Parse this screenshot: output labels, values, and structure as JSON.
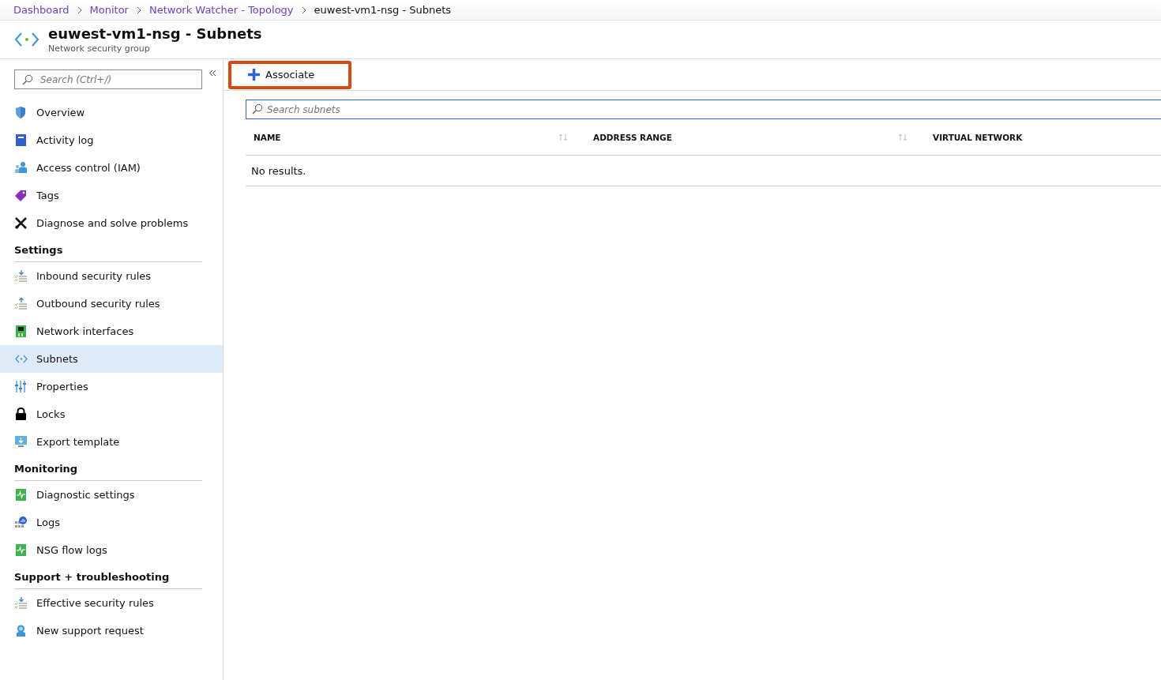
{
  "breadcrumb": [
    {
      "label": "Dashboard",
      "current": false
    },
    {
      "label": "Monitor",
      "current": false
    },
    {
      "label": "Network Watcher - Topology",
      "current": false
    },
    {
      "label": "euwest-vm1-nsg - Subnets",
      "current": true
    }
  ],
  "header": {
    "title": "euwest-vm1-nsg - Subnets",
    "subtitle": "Network security group"
  },
  "sidebar": {
    "search": {
      "placeholder": "Search (Ctrl+/)"
    },
    "groups": [
      {
        "items": [
          {
            "label": "Overview",
            "kind": "shield",
            "selected": false
          },
          {
            "label": "Activity log",
            "kind": "book",
            "selected": false
          },
          {
            "label": "Access control (IAM)",
            "kind": "people",
            "selected": false
          },
          {
            "label": "Tags",
            "kind": "tag",
            "selected": false
          },
          {
            "label": "Diagnose and solve problems",
            "kind": "tools",
            "selected": false
          }
        ]
      },
      {
        "heading": "Settings",
        "items": [
          {
            "label": "Inbound security rules",
            "kind": "inbound",
            "selected": false
          },
          {
            "label": "Outbound security rules",
            "kind": "outbound",
            "selected": false
          },
          {
            "label": "Network interfaces",
            "kind": "nic",
            "selected": false
          },
          {
            "label": "Subnets",
            "kind": "subnet",
            "selected": true
          },
          {
            "label": "Properties",
            "kind": "properties",
            "selected": false
          },
          {
            "label": "Locks",
            "kind": "lock",
            "selected": false
          },
          {
            "label": "Export template",
            "kind": "export",
            "selected": false
          }
        ]
      },
      {
        "heading": "Monitoring",
        "items": [
          {
            "label": "Diagnostic settings",
            "kind": "diagnostic",
            "selected": false
          },
          {
            "label": "Logs",
            "kind": "logs",
            "selected": false
          },
          {
            "label": "NSG flow logs",
            "kind": "diagnostic",
            "selected": false
          }
        ]
      },
      {
        "heading": "Support + troubleshooting",
        "items": [
          {
            "label": "Effective security rules",
            "kind": "inbound",
            "selected": false
          },
          {
            "label": "New support request",
            "kind": "support",
            "selected": false
          }
        ]
      }
    ]
  },
  "toolbar": [
    {
      "label": "Associate",
      "highlighted": true
    }
  ],
  "search": {
    "placeholder": "Search subnets"
  },
  "table": {
    "columns": [
      {
        "label": "NAME",
        "sortable": true
      },
      {
        "label": "ADDRESS RANGE",
        "sortable": true
      },
      {
        "label": "VIRTUAL NETWORK",
        "sortable": false
      }
    ],
    "empty_message": "No results."
  }
}
